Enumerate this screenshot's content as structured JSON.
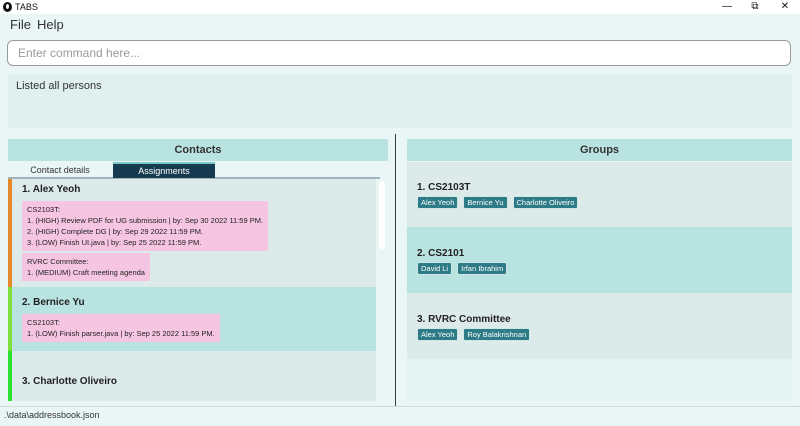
{
  "window": {
    "title": "TABS"
  },
  "menu": {
    "file": "File",
    "help": "Help"
  },
  "command": {
    "placeholder": "Enter command here..."
  },
  "result": {
    "text": "Listed all persons"
  },
  "contacts_panel": {
    "title": "Contacts",
    "tabs": [
      "Contact details",
      "Assignments"
    ],
    "cards": [
      {
        "name": "1.  Alex Yeoh",
        "bar_color": "#e5892a",
        "groups": [
          {
            "lines": [
              "CS2103T:",
              "1. (HIGH) Review PDF for UG submission | by: Sep 30 2022 11:59 PM.",
              "2. (HIGH) Complete DG | by: Sep 29 2022 11:59 PM.",
              "3. (LOW) Finish UI.java | by: Sep 25 2022 11:59 PM."
            ]
          },
          {
            "lines": [
              "RVRC Committee:",
              "1. (MEDIUM) Craft meeting agenda"
            ]
          }
        ]
      },
      {
        "name": "2.  Bernice Yu",
        "bar_color": "#7ee03a",
        "groups": [
          {
            "lines": [
              "CS2103T:",
              "1. (LOW) Finish parser.java | by: Sep 25 2022 11:59 PM."
            ]
          }
        ]
      },
      {
        "name": "3.  Charlotte Oliveiro",
        "bar_color": "#2ee02e",
        "groups": []
      }
    ]
  },
  "groups_panel": {
    "title": "Groups",
    "groups": [
      {
        "name": "1.  CS2103T",
        "members": [
          "Alex Yeoh",
          "Bernice Yu",
          "Charlotte Oliveiro"
        ]
      },
      {
        "name": "2.  CS2101",
        "members": [
          "David Li",
          "Irfan Ibrahim"
        ]
      },
      {
        "name": "3.  RVRC Committee",
        "members": [
          "Alex Yeoh",
          "Roy Balakrishnan"
        ]
      }
    ]
  },
  "status": {
    "path": ".\\data\\addressbook.json"
  },
  "colors": {
    "accent": "#163b50",
    "tag": "#2d7b86",
    "assignment_bg": "#f6c5e2",
    "header": "#b9e3e0"
  }
}
